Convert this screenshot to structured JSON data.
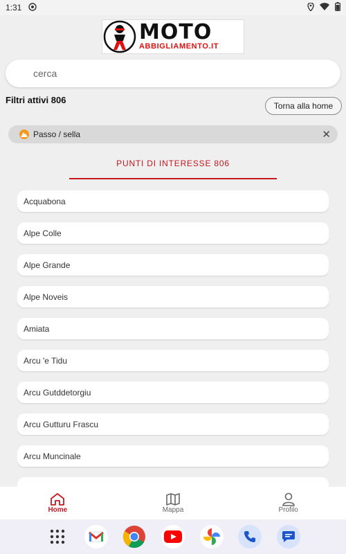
{
  "status_bar": {
    "time": "1:31"
  },
  "logo": {
    "brand": "MOTO",
    "sub": "ABBIGLIAMENTO.IT"
  },
  "search": {
    "placeholder": "cerca"
  },
  "filters": {
    "active_label": "Filtri attivi 806",
    "home_button": "Torna alla home"
  },
  "chip": {
    "label": "Passo / sella",
    "icon": "mountain-pass-icon",
    "color": "#f39a1f"
  },
  "poi": {
    "title": "PUNTI DI INTERESSE 806",
    "accent": "#c3181f"
  },
  "items": [
    {
      "label": "Acquabona"
    },
    {
      "label": "Alpe Colle"
    },
    {
      "label": "Alpe Grande"
    },
    {
      "label": "Alpe Noveis"
    },
    {
      "label": "Amiata"
    },
    {
      "label": "Arcu 'e Tidu"
    },
    {
      "label": "Arcu Gutddetorgiu"
    },
    {
      "label": "Arcu Gutturu Frascu"
    },
    {
      "label": "Arcu Muncinale"
    }
  ],
  "nav": [
    {
      "label": "Home",
      "icon": "home-icon",
      "active": true
    },
    {
      "label": "Mappa",
      "icon": "map-icon",
      "active": false
    },
    {
      "label": "Profilo",
      "icon": "profile-icon",
      "active": false
    }
  ],
  "dock": [
    "app-drawer-icon",
    "gmail-icon",
    "chrome-icon",
    "youtube-icon",
    "photos-icon",
    "phone-icon",
    "messages-icon"
  ]
}
